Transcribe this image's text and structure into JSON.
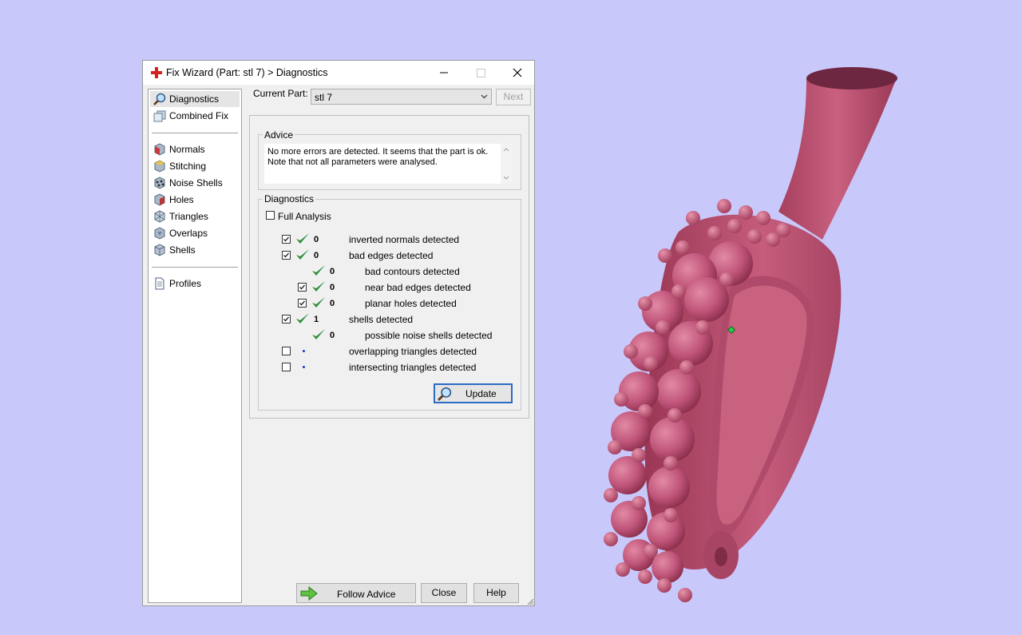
{
  "window": {
    "title": "Fix Wizard (Part: stl 7) > Diagnostics",
    "minimize_glyph": "—",
    "maximize_glyph": "☐",
    "close_glyph": "✕"
  },
  "nav": {
    "items": [
      {
        "label": "Diagnostics",
        "icon": "magnifier-icon",
        "selected": true
      },
      {
        "label": "Combined Fix",
        "icon": "cubes-icon"
      },
      {
        "label": "Normals",
        "icon": "cube-red-icon"
      },
      {
        "label": "Stitching",
        "icon": "cube-stitch-icon"
      },
      {
        "label": "Noise Shells",
        "icon": "noise-shells-icon"
      },
      {
        "label": "Holes",
        "icon": "cube-holes-icon"
      },
      {
        "label": "Triangles",
        "icon": "triangles-icon"
      },
      {
        "label": "Overlaps",
        "icon": "overlaps-icon"
      },
      {
        "label": "Shells",
        "icon": "shells-icon"
      },
      {
        "label": "Profiles",
        "icon": "document-icon"
      }
    ]
  },
  "part": {
    "label": "Current Part:",
    "value": "stl 7",
    "next_label": "Next"
  },
  "advice": {
    "legend": "Advice",
    "lines": [
      "No more errors are detected. It seems that the part is ok.",
      "Note that not all parameters were analysed."
    ]
  },
  "diagnostics": {
    "legend": "Diagnostics",
    "full_analysis_label": "Full Analysis",
    "full_analysis_checked": false,
    "rows": [
      {
        "checkbox": true,
        "checked": true,
        "status": "ok",
        "count": "0",
        "label": "inverted normals detected",
        "indent": 0
      },
      {
        "checkbox": true,
        "checked": true,
        "status": "ok",
        "count": "0",
        "label": "bad edges detected",
        "indent": 0
      },
      {
        "checkbox": false,
        "checked": false,
        "status": "ok",
        "count": "0",
        "label": "bad contours detected",
        "indent": 1
      },
      {
        "checkbox": true,
        "checked": true,
        "status": "ok",
        "count": "0",
        "label": "near bad edges detected",
        "indent": 1
      },
      {
        "checkbox": true,
        "checked": true,
        "status": "ok",
        "count": "0",
        "label": "planar holes detected",
        "indent": 1
      },
      {
        "checkbox": true,
        "checked": true,
        "status": "ok",
        "count": "1",
        "label": "shells detected",
        "indent": 0
      },
      {
        "checkbox": false,
        "checked": false,
        "status": "ok",
        "count": "0",
        "label": "possible noise shells detected",
        "indent": 1
      },
      {
        "checkbox": true,
        "checked": false,
        "status": "pending",
        "count": "",
        "label": "overlapping triangles detected",
        "indent": 0
      },
      {
        "checkbox": true,
        "checked": false,
        "status": "pending",
        "count": "",
        "label": "intersecting triangles detected",
        "indent": 0
      }
    ],
    "update_label": "Update"
  },
  "footer": {
    "follow_advice_label": "Follow Advice",
    "close_label": "Close",
    "help_label": "Help"
  },
  "colors": {
    "background": "#c9c8fb",
    "model": "#b8506e",
    "check_green": "#2e8b3a",
    "title_icon_red": "#d4231c"
  }
}
